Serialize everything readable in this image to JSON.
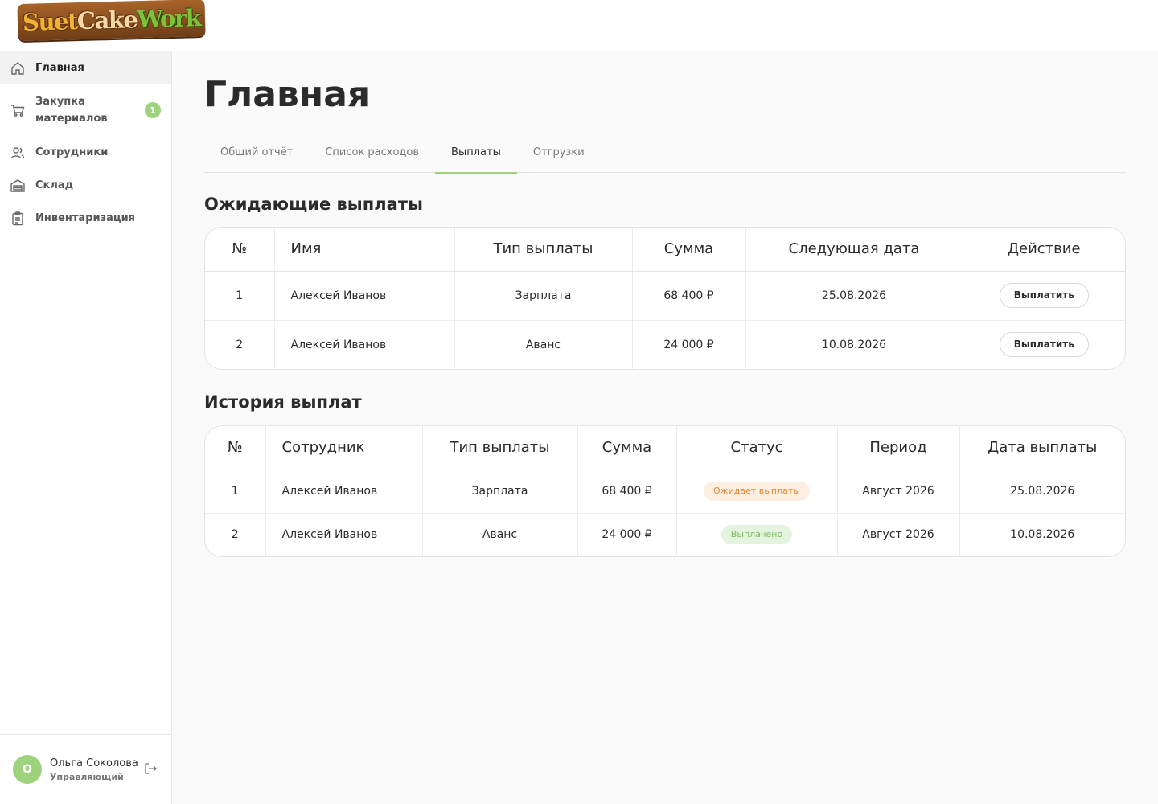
{
  "brand": {
    "logo_part1": "Suet",
    "logo_part2": "Cake",
    "logo_part3": "Work"
  },
  "sidebar": {
    "items": [
      {
        "label": "Главная",
        "icon": "home-icon",
        "active": true
      },
      {
        "label": "Закупка материалов",
        "icon": "cart-icon",
        "badge": "1"
      },
      {
        "label": "Сотрудники",
        "icon": "users-icon"
      },
      {
        "label": "Склад",
        "icon": "warehouse-icon"
      },
      {
        "label": "Инвентаризация",
        "icon": "clipboard-icon"
      }
    ]
  },
  "user": {
    "initial": "О",
    "name": "Ольга Соколова",
    "role": "Управляющий"
  },
  "page": {
    "title": "Главная"
  },
  "tabs": [
    {
      "label": "Общий отчёт"
    },
    {
      "label": "Список расходов"
    },
    {
      "label": "Выплаты",
      "active": true
    },
    {
      "label": "Отгрузки"
    }
  ],
  "pending": {
    "title": "Ожидающие выплаты",
    "headers": [
      "№",
      "Имя",
      "Тип выплаты",
      "Сумма",
      "Следующая дата",
      "Действие"
    ],
    "rows": [
      {
        "num": "1",
        "name": "Алексей Иванов",
        "type": "Зарплата",
        "amount": "68 400 ₽",
        "next_date": "25.08.2026",
        "action": "Выплатить"
      },
      {
        "num": "2",
        "name": "Алексей Иванов",
        "type": "Аванс",
        "amount": "24 000 ₽",
        "next_date": "10.08.2026",
        "action": "Выплатить"
      }
    ]
  },
  "history": {
    "title": "История выплат",
    "headers": [
      "№",
      "Сотрудник",
      "Тип выплаты",
      "Сумма",
      "Статус",
      "Период",
      "Дата выплаты"
    ],
    "rows": [
      {
        "num": "1",
        "employee": "Алексей Иванов",
        "type": "Зарплата",
        "amount": "68 400 ₽",
        "status": "Ожидает выплаты",
        "period": "Август 2026",
        "date": "25.08.2026"
      },
      {
        "num": "2",
        "employee": "Алексей Иванов",
        "type": "Аванс",
        "amount": "24 000 ₽",
        "status": "Выплачено",
        "period": "Август 2026",
        "date": "10.08.2026"
      }
    ]
  },
  "colors": {
    "accent": "#9ed27c",
    "status_waiting": "#e08a3c",
    "status_paid": "#7bbd5f"
  }
}
